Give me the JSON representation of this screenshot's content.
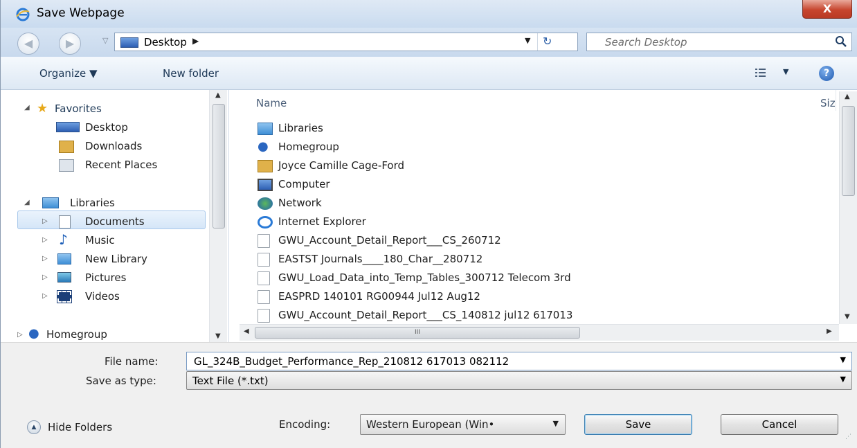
{
  "window": {
    "title": "Save Webpage",
    "close_label": "X"
  },
  "address_bar": {
    "location": "Desktop",
    "search_placeholder": "Search Desktop"
  },
  "commands": {
    "organize": "Organize ▼",
    "new_folder": "New folder"
  },
  "nav_tree": {
    "favorites": "Favorites",
    "favorites_items": [
      "Desktop",
      "Downloads",
      "Recent Places"
    ],
    "libraries": "Libraries",
    "libraries_items": [
      "Documents",
      "Music",
      "New Library",
      "Pictures",
      "Videos"
    ],
    "homegroup": "Homegroup",
    "selected": "Documents"
  },
  "file_list": {
    "column_name": "Name",
    "column_size": "Siz",
    "items": [
      {
        "label": "Libraries",
        "icon": "libraries-icon"
      },
      {
        "label": "Homegroup",
        "icon": "homegroup-icon"
      },
      {
        "label": "Joyce Camille Cage-Ford",
        "icon": "user-folder-icon"
      },
      {
        "label": "Computer",
        "icon": "computer-icon"
      },
      {
        "label": "Network",
        "icon": "network-icon"
      },
      {
        "label": "Internet Explorer",
        "icon": "internet-explorer-icon"
      },
      {
        "label": "GWU_Account_Detail_Report___CS_260712",
        "icon": "document-icon"
      },
      {
        "label": "EASTST Journals____180_Char__280712",
        "icon": "document-icon"
      },
      {
        "label": "GWU_Load_Data_into_Temp_Tables_300712 Telecom 3rd",
        "icon": "document-icon"
      },
      {
        "label": "EASPRD 140101 RG00944 Jul12 Aug12",
        "icon": "document-icon"
      },
      {
        "label": "GWU_Account_Detail_Report___CS_140812 jul12 617013",
        "icon": "document-icon"
      }
    ],
    "hscroll_grip": "III"
  },
  "form": {
    "file_name_label": "File name:",
    "file_name_value": "GL_324B_Budget_Performance_Rep_210812 617013 082112",
    "save_as_type_label": "Save as type:",
    "save_as_type_value": "Text File (*.txt)"
  },
  "footer": {
    "hide_folders": "Hide Folders",
    "encoding_label": "Encoding:",
    "encoding_value": "Western European (Win•",
    "save": "Save",
    "cancel": "Cancel"
  },
  "colors": {
    "titlebar": "#dfe9f5",
    "close": "#c7452e",
    "selection": "#d5e6f8",
    "accent": "#1c58b0"
  }
}
